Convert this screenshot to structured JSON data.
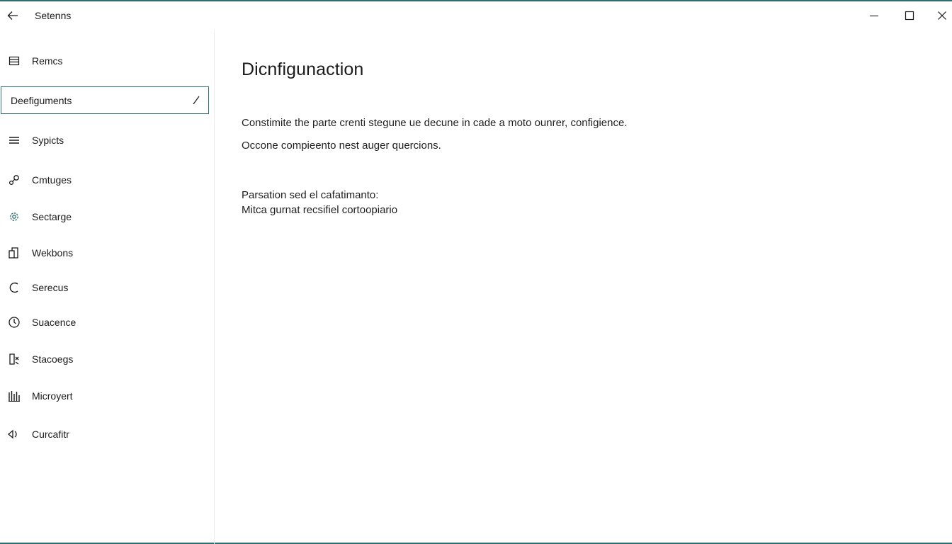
{
  "window": {
    "title": "Setenns",
    "accent_color": "#2f6f73"
  },
  "titlebar": {
    "back_icon": "arrow-left-icon",
    "minimize_icon": "minimize-icon",
    "maximize_icon": "maximize-icon",
    "close_icon": "close-icon"
  },
  "sidebar": {
    "items": [
      {
        "label": "Remcs",
        "icon": "list-icon"
      },
      {
        "label": "Deefiguments",
        "icon": "",
        "selected": true
      },
      {
        "label": "Sypicts",
        "icon": "lines-icon"
      },
      {
        "label": "Cmtuges",
        "icon": "link-icon"
      },
      {
        "label": "Sectarge",
        "icon": "gear-icon"
      },
      {
        "label": "Wekbons",
        "icon": "devices-icon"
      },
      {
        "label": "Serecus",
        "icon": "arc-icon"
      },
      {
        "label": "Suacence",
        "icon": "clock-icon"
      },
      {
        "label": "Stacoegs",
        "icon": "storage-icon"
      },
      {
        "label": "Microyert",
        "icon": "bars-icon"
      },
      {
        "label": "Curcafitr",
        "icon": "speaker-icon"
      }
    ]
  },
  "main": {
    "title": "Dicnfigunaction",
    "paragraph1": "Constimite the parte crenti stegune ue decune in cade a moto ounrer, configience.",
    "paragraph2": "Occone compieento nest auger quercions.",
    "paragraph3": "Parsation sed el cafatimanto:",
    "paragraph4": "Mitca gurnat recsifiel cortoopiario"
  }
}
